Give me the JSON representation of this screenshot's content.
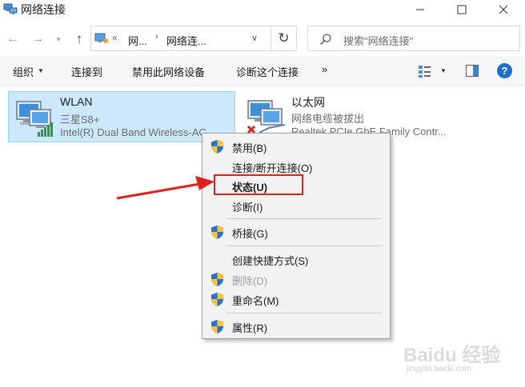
{
  "window": {
    "title": "网络连接",
    "icons": {
      "title": "network-connections-icon",
      "minimize": "minimize-icon",
      "maximize": "maximize-icon",
      "close": "close-icon"
    }
  },
  "address_bar": {
    "crumbs": [
      "网...",
      "网络连..."
    ],
    "search_placeholder": "搜索\"网络连接\""
  },
  "command_bar": {
    "organize": "组织",
    "connect_to": "连接到",
    "disable_device": "禁用此网络设备",
    "diagnose": "诊断这个连接",
    "more": "»"
  },
  "items": [
    {
      "name": "WLAN",
      "status": "三星S8+",
      "device": "Intel(R) Dual Band Wireless-AC",
      "selected": true,
      "icon": "wifi-adapter-icon"
    },
    {
      "name": "以太网",
      "status": "网络电缆被拔出",
      "device": "Realtek PCIe GbE Family Contr...",
      "selected": false,
      "icon": "ethernet-adapter-disconnected-icon"
    }
  ],
  "context_menu": {
    "disable": "禁用(B)",
    "connect_disconnect": "连接/断开连接(O)",
    "status": "状态(U)",
    "diagnose": "诊断(I)",
    "bridge": "桥接(G)",
    "create_shortcut": "创建快捷方式(S)",
    "delete": "删除(D)",
    "rename": "重命名(M)",
    "properties": "属性(R)"
  },
  "watermark": {
    "logo": "Baidu 经验",
    "url": "jingyan.baidu.com"
  },
  "colors": {
    "selection_bg": "#cce8ff",
    "annotation_red": "#e0201b",
    "help_blue": "#1d6fce"
  }
}
